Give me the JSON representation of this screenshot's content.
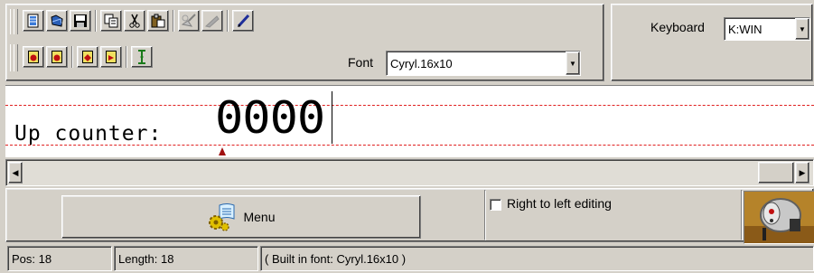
{
  "toolbar": {
    "row1_buttons": [
      {
        "name": "new-document-icon"
      },
      {
        "name": "open-file-icon"
      },
      {
        "name": "save-disk-icon"
      },
      {
        "name": "copy-icon"
      },
      {
        "name": "cut-scissors-icon"
      },
      {
        "name": "paste-clipboard-icon"
      },
      {
        "name": "clear-brush-icon"
      },
      {
        "name": "eraser-icon"
      },
      {
        "name": "pen-edit-icon"
      }
    ],
    "row2_buttons": [
      {
        "name": "page-red-icon-1"
      },
      {
        "name": "page-red-icon-2"
      },
      {
        "name": "page-red-icon-3"
      },
      {
        "name": "page-red-icon-4"
      },
      {
        "name": "cursor-ibeam-icon"
      }
    ]
  },
  "font_select": {
    "label": "Font",
    "value": "Cyryl.16x10"
  },
  "keyboard_select": {
    "label": "Keyboard",
    "value": "K:WIN"
  },
  "editor": {
    "text_small": "Up counter:",
    "text_large": "0000",
    "dash_color": "#e02020"
  },
  "menu_button": {
    "label": "Menu",
    "icon": "gears-scroll-icon"
  },
  "rtl_checkbox": {
    "label": "Right to left editing",
    "checked": false
  },
  "status": {
    "pos": "Pos: 18",
    "length": "Length: 18",
    "font_info": "( Built in font: Cyryl.16x10 )"
  }
}
